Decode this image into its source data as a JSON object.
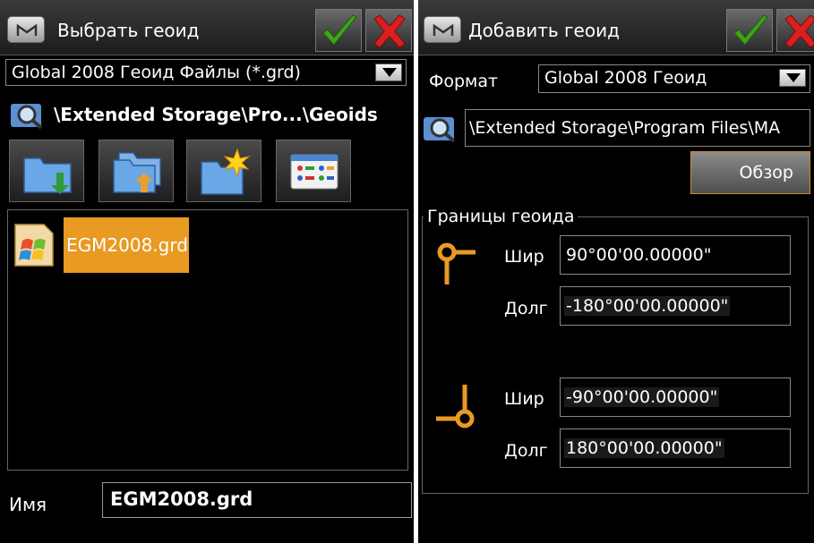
{
  "left": {
    "title": "Выбрать геоид",
    "filter": "Global 2008 Геоид Файлы (*.grd)",
    "path": "\\Extended Storage\\Pro...\\Geoids",
    "tool_icons": [
      "folder-down-icon",
      "folder-up-icon",
      "new-folder-icon",
      "list-view-icon"
    ],
    "files": [
      {
        "name": "EGM2008.grd",
        "icon": "windows-file-icon"
      }
    ],
    "name_label": "Имя",
    "name_value": "EGM2008.grd"
  },
  "right": {
    "title": "Добавить геоид",
    "format_label": "Формат",
    "format_value": "Global 2008 Геоид",
    "path_value": "\\Extended Storage\\Program Files\\MA",
    "browse_label": "Обзор",
    "group_title": "Границы геоида",
    "top_left": {
      "lat_label": "Шир",
      "lat": "90°00'00.00000\"",
      "lon_label": "Долг",
      "lon": "-180°00'00.00000\""
    },
    "bottom_right": {
      "lat_label": "Шир",
      "lat": "-90°00'00.00000\"",
      "lon_label": "Долг",
      "lon": "180°00'00.00000\""
    }
  },
  "colors": {
    "accent": "#e89a23",
    "ok": "#3fa31e",
    "cancel": "#d91f1f"
  }
}
